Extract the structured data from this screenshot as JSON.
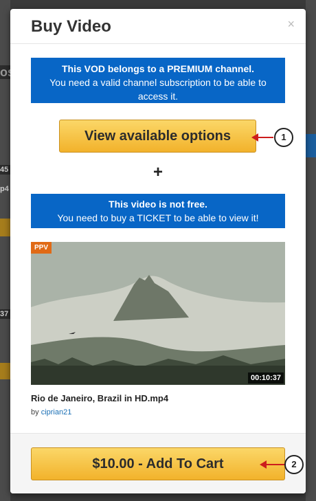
{
  "modal": {
    "title": "Buy Video",
    "close_icon": "×"
  },
  "premium_notice": {
    "headline": "This VOD belongs to a PREMIUM channel.",
    "line1": "You need a valid channel subscription to be able to",
    "line2": "access it."
  },
  "view_options_label": "View available options",
  "plus_sign": "+",
  "ticket_notice": {
    "headline": "This video is not free.",
    "line1": "You need to buy a TICKET to be able to view it!"
  },
  "video": {
    "badge": "PPV",
    "duration": "00:10:37",
    "title": "Rio de Janeiro, Brazil in HD.mp4",
    "by_label": "by",
    "author": "ciprian21"
  },
  "add_to_cart_label": "$10.00 - Add To Cart",
  "callouts": {
    "first": "1",
    "second": "2"
  },
  "background_fragments": {
    "left_chip_1": "45",
    "left_chip_2": "p4",
    "left_chip_3": "37",
    "left_chip_4": "os"
  },
  "colors": {
    "info_blue": "#0866c6",
    "button_yellow": "#f2b22b",
    "ppv_orange": "#e06a16",
    "callout_red": "#cc1d1d",
    "link_blue": "#1a6fb5"
  }
}
